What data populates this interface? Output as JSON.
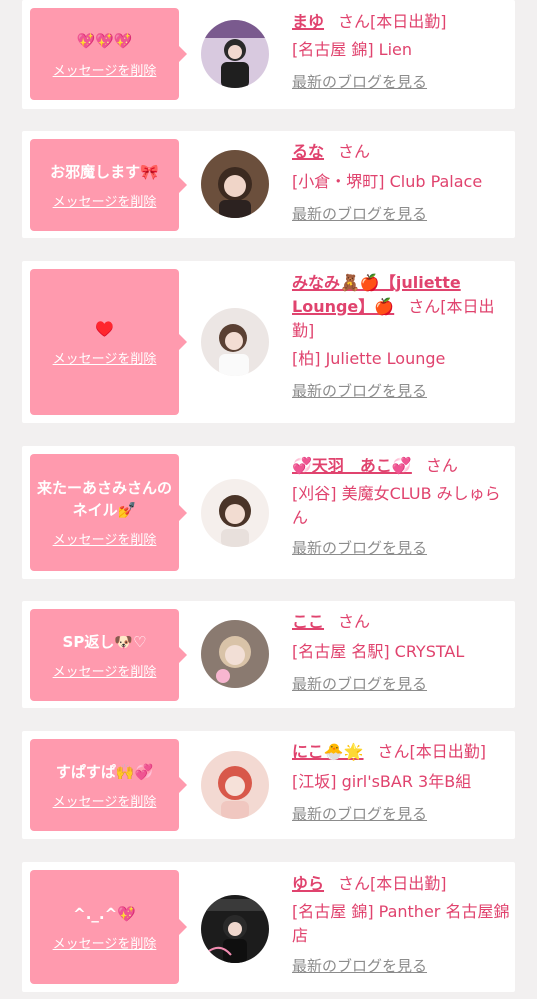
{
  "theme": {
    "bubble": "#ff9aae",
    "accent": "#e0436e",
    "blog_link": "#8c8c8c",
    "background": "#f2f0f0"
  },
  "delete_label": "メッセージを削除",
  "blog_label": "最新のブログを見る",
  "san": "さん",
  "cards": [
    {
      "message": "💖💖💖",
      "name": "まゆ",
      "status": "[本日出勤]",
      "shop": "[名古屋 錦] Lien",
      "avatar_icon": "photo-avatar"
    },
    {
      "message": "お邪魔します🎀",
      "name": "るな",
      "status": "",
      "shop": "[小倉・堺町] Club Palace",
      "avatar_icon": "photo-avatar"
    },
    {
      "message": "♥️",
      "name": "みなみ🧸🍎【juliette Lounge】🍎",
      "status": "[本日出勤]",
      "shop": "[柏] Juliette Lounge",
      "avatar_icon": "photo-avatar"
    },
    {
      "message": "来たーあさみさんのネイル💅",
      "name": "💞天羽　あこ💞",
      "status": "",
      "shop": "[刈谷] 美魔女CLUB みしゅらん",
      "avatar_icon": "photo-avatar"
    },
    {
      "message": "SP返し🐶♡",
      "name": "ここ",
      "status": "",
      "shop": "[名古屋 名駅] CRYSTAL",
      "avatar_icon": "photo-avatar"
    },
    {
      "message": "すぱすぱ🙌💞",
      "name": "にこ🐣🌟",
      "status": "[本日出勤]",
      "shop": "[江坂] girl'sBAR 3年B組",
      "avatar_icon": "photo-avatar"
    },
    {
      "message": "^._.^💖",
      "name": "ゆら",
      "status": "[本日出勤]",
      "shop": "[名古屋 錦] Panther 名古屋錦店",
      "avatar_icon": "photo-avatar"
    }
  ]
}
